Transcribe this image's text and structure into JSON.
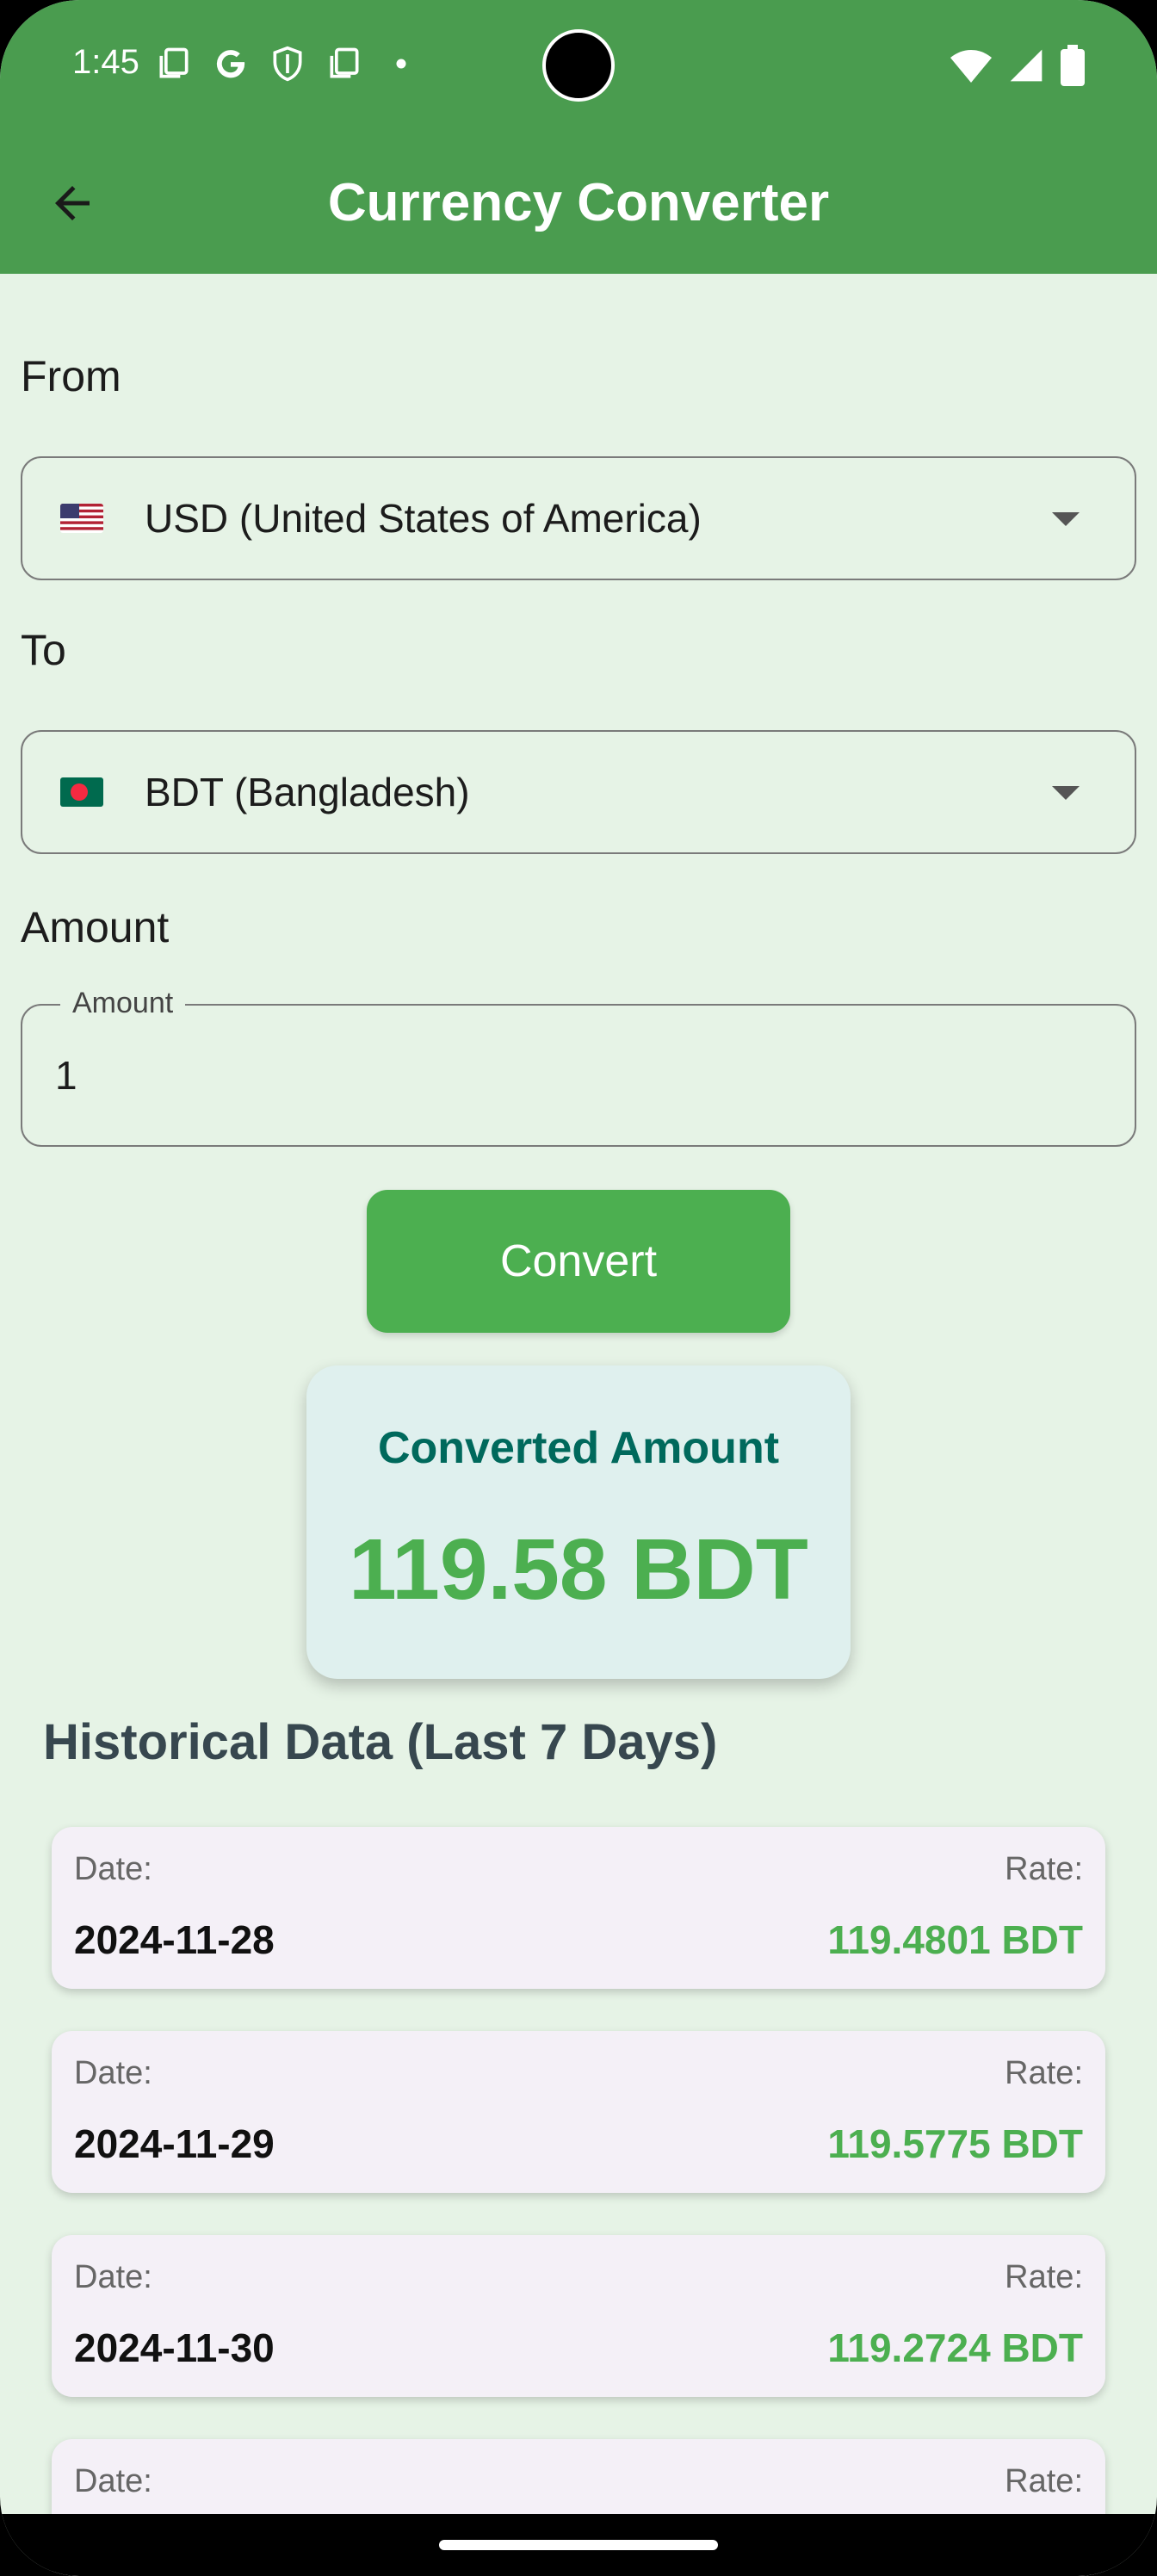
{
  "status_bar": {
    "time": "1:45",
    "left_icons": [
      "copy-icon",
      "google-icon",
      "shield-icon",
      "copy-icon",
      "dot-icon"
    ],
    "right_icons": [
      "wifi-icon",
      "signal-icon",
      "battery-icon"
    ]
  },
  "app_bar": {
    "title": "Currency Converter",
    "back_icon": "arrow-back-icon",
    "color": "#4a9c4f"
  },
  "form": {
    "from_label": "From",
    "from_value": "USD (United States of America)",
    "to_label": "To",
    "to_value": "BDT (Bangladesh)",
    "amount_label": "Amount",
    "amount_field_label": "Amount",
    "amount_value": "1",
    "convert_label": "Convert"
  },
  "result": {
    "title": "Converted Amount",
    "value": "119.58 BDT"
  },
  "history": {
    "title": "Historical Data (Last 7 Days)",
    "date_label": "Date:",
    "rate_label": "Rate:",
    "rows": [
      {
        "date": "2024-11-28",
        "rate": "119.4801 BDT"
      },
      {
        "date": "2024-11-29",
        "rate": "119.5775 BDT"
      },
      {
        "date": "2024-11-30",
        "rate": "119.2724 BDT"
      },
      {
        "date": "",
        "rate": ""
      }
    ]
  },
  "colors": {
    "accent": "#4caf50",
    "background": "#e6f3e6",
    "result_title": "#00695c"
  }
}
